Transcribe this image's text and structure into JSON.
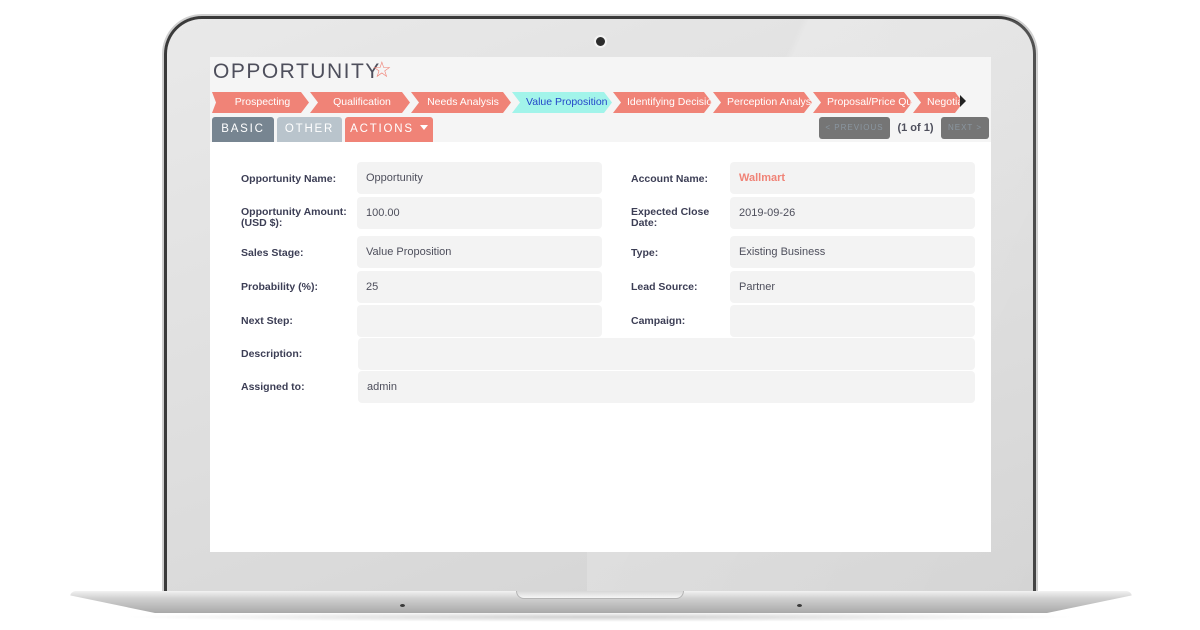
{
  "page": {
    "title": "OPPORTUNITY",
    "favorite_icon": "star-outline-icon"
  },
  "sales_stages": {
    "items": [
      {
        "label": "Prospecting",
        "active": false
      },
      {
        "label": "Qualification",
        "active": false
      },
      {
        "label": "Needs Analysis",
        "active": false
      },
      {
        "label": "Value Proposition",
        "active": true
      },
      {
        "label": "Identifying Decision",
        "active": false
      },
      {
        "label": "Perception Analysis",
        "active": false
      },
      {
        "label": "Proposal/Price Quote",
        "active": false
      },
      {
        "label": "Negotiation",
        "active": false
      }
    ],
    "more_icon": "triangle-right-icon"
  },
  "tabs": {
    "basic": "BASIC",
    "other": "OTHER",
    "actions": "ACTIONS"
  },
  "pagination": {
    "previous": "< PREVIOUS",
    "count": "(1 of 1)",
    "next": "NEXT >"
  },
  "fields": {
    "opportunity_name": {
      "label": "Opportunity Name:",
      "value": "Opportunity"
    },
    "opportunity_amount": {
      "label": "Opportunity Amount: (USD $):",
      "value": "100.00"
    },
    "sales_stage": {
      "label": "Sales Stage:",
      "value": "Value Proposition"
    },
    "probability": {
      "label": "Probability (%):",
      "value": "25"
    },
    "next_step": {
      "label": "Next Step:",
      "value": ""
    },
    "description": {
      "label": "Description:",
      "value": ""
    },
    "assigned_to": {
      "label": "Assigned to:",
      "value": "admin"
    },
    "account_name": {
      "label": "Account Name:",
      "value": "Wallmart"
    },
    "expected_close_date": {
      "label": "Expected Close Date:",
      "value": "2019-09-26"
    },
    "type": {
      "label": "Type:",
      "value": "Existing Business"
    },
    "lead_source": {
      "label": "Lead Source:",
      "value": "Partner"
    },
    "campaign": {
      "label": "Campaign:",
      "value": ""
    }
  },
  "colors": {
    "accent": "#f08377",
    "active_stage": "#a2f4ea",
    "tab_basic": "#778591",
    "tab_other": "#b9c4cc"
  }
}
